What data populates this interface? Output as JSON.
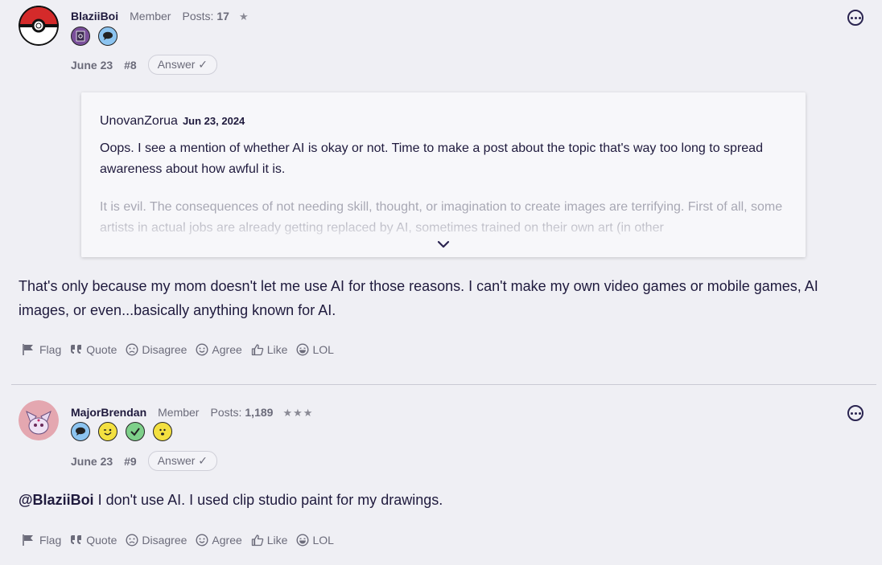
{
  "posts": [
    {
      "username": "BlaziiBoi",
      "role": "Member",
      "posts_label": "Posts:",
      "posts_count": "17",
      "stars": "★",
      "date": "June 23",
      "post_number": "#8",
      "answer_label": "Answer ✓",
      "quote": {
        "author": "UnovanZorua",
        "date": "Jun 23, 2024",
        "paragraph1": "Oops. I see a mention of whether AI is okay or not. Time to make a post about the topic that's way too long to spread awareness about how awful it is.",
        "paragraph2": "It is evil. The consequences of not needing skill, thought, or imagination to create images are terrifying. First of all, some artists in actual jobs are already getting replaced by AI, sometimes trained on their own art (in other"
      },
      "body": "That's only because my mom doesn't let me use AI for those reasons. I can't make my own video games or mobile games, AI images, or even...basically anything known for AI."
    },
    {
      "username": "MajorBrendan",
      "role": "Member",
      "posts_label": "Posts:",
      "posts_count": "1,189",
      "stars": "★★★",
      "date": "June 23",
      "post_number": "#9",
      "answer_label": "Answer ✓",
      "mention": "@BlaziiBoi",
      "body": " I don't use AI. I used clip studio paint for my drawings."
    }
  ],
  "actions": {
    "flag": "Flag",
    "quote": "Quote",
    "disagree": "Disagree",
    "agree": "Agree",
    "like": "Like",
    "lol": "LOL"
  }
}
